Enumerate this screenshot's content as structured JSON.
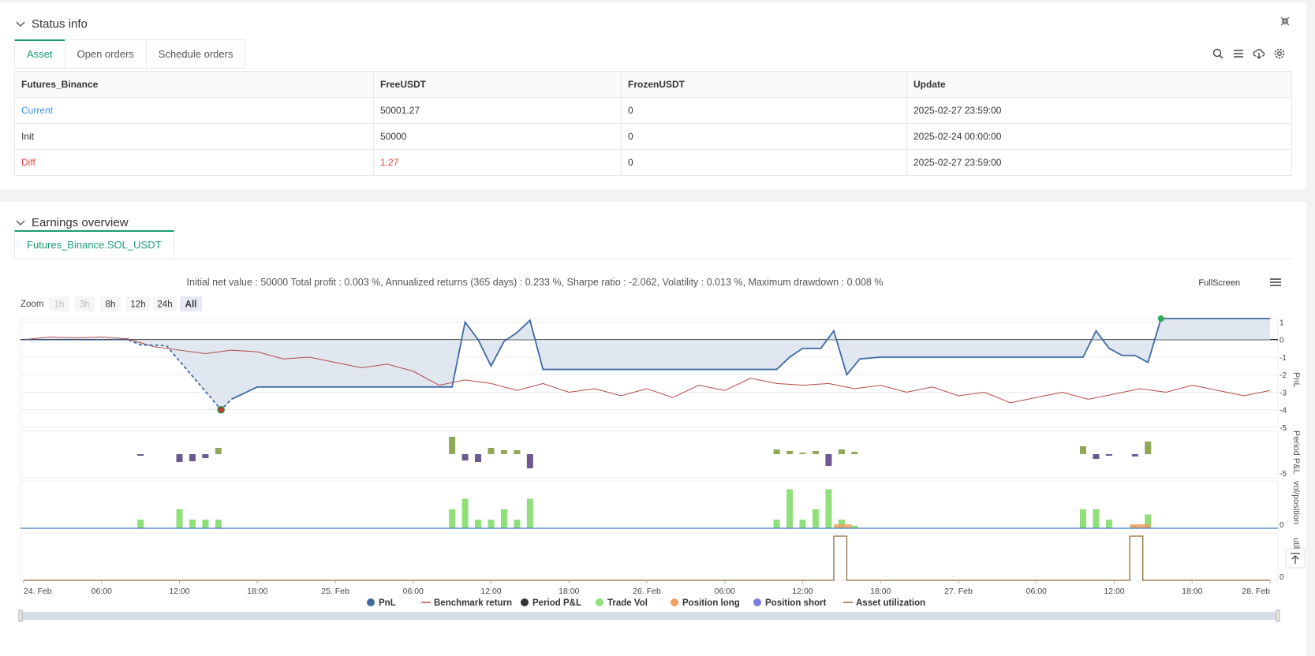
{
  "status": {
    "title": "Status info",
    "tabs": [
      "Asset",
      "Open orders",
      "Schedule orders"
    ],
    "table": {
      "headers": [
        "Futures_Binance",
        "FreeUSDT",
        "FrozenUSDT",
        "Update"
      ],
      "rows": [
        {
          "label": "Current",
          "free": "50001.27",
          "frozen": "0",
          "update": "2025-02-27 23:59:00",
          "color": "#3a8ee6"
        },
        {
          "label": "Init",
          "free": "50000",
          "frozen": "0",
          "update": "2025-02-24 00:00:00",
          "color": "#333333"
        },
        {
          "label": "Diff",
          "free": "1.27",
          "frozen": "0",
          "update": "2025-02-27 23:59:00",
          "color": "#e64545"
        }
      ]
    }
  },
  "earnings": {
    "title": "Earnings overview",
    "tab": "Futures_Binance.SOL_USDT",
    "summary": "Initial net value : 50000 Total profit : 0.003 %, Annualized returns (365 days) : 0.233 %, Sharpe ratio : -2.062, Volatility : 0.013 %, Maximum drawdown : 0.008 %",
    "fullscreen": "FullScreen",
    "zoom_label": "Zoom",
    "zoom_options": [
      "1h",
      "3h",
      "8h",
      "12h",
      "24h",
      "All"
    ]
  },
  "chart_data": {
    "type": "line",
    "x_labels": [
      "24. Feb",
      "06:00",
      "12:00",
      "18:00",
      "25. Feb",
      "06:00",
      "12:00",
      "18:00",
      "26. Feb",
      "06:00",
      "12:00",
      "18:00",
      "27. Feb",
      "06:00",
      "12:00",
      "18:00",
      "28. Feb"
    ],
    "pnl_axis": {
      "label": "PnL",
      "ticks": [
        "1",
        "0",
        "-1",
        "-2",
        "-3",
        "-4",
        "-5"
      ],
      "range": [
        -5,
        1.2
      ]
    },
    "period_axis": {
      "label": "Period P&L",
      "ticks": [
        "-5"
      ]
    },
    "vol_axis": {
      "label": "vol/position",
      "ticks": [
        "0"
      ]
    },
    "util_axis": {
      "label": "utili...on",
      "ticks": [
        "0"
      ]
    },
    "series": [
      {
        "name": "PnL",
        "color": "#3e6aa0",
        "points": [
          [
            0,
            0
          ],
          [
            4,
            0
          ],
          [
            4.5,
            -0.3
          ],
          [
            5.5,
            -0.35
          ],
          [
            7.2,
            -3.3
          ],
          [
            7.6,
            -4
          ],
          [
            8,
            -3.4
          ],
          [
            9,
            -2.7
          ],
          [
            16,
            -2.7
          ],
          [
            16.5,
            -2.7
          ],
          [
            17,
            1
          ],
          [
            17.5,
            0
          ],
          [
            18,
            -1.5
          ],
          [
            18.5,
            -0.1
          ],
          [
            19,
            0.4
          ],
          [
            19.5,
            1.1
          ],
          [
            20,
            -1.7
          ],
          [
            29,
            -1.7
          ],
          [
            29.5,
            -1
          ],
          [
            30,
            -0.5
          ],
          [
            30.7,
            -0.5
          ],
          [
            31.2,
            0.5
          ],
          [
            31.7,
            -2
          ],
          [
            32.2,
            -1.1
          ],
          [
            33,
            -1
          ],
          [
            40.8,
            -1
          ],
          [
            41.3,
            0.5
          ],
          [
            41.8,
            -0.5
          ],
          [
            42.3,
            -0.9
          ],
          [
            42.8,
            -0.9
          ],
          [
            43.3,
            -1.3
          ],
          [
            43.8,
            1.2
          ],
          [
            48,
            1.2
          ]
        ]
      },
      {
        "name": "Benchmark return",
        "color": "#b34a4a",
        "points": [
          [
            0,
            0
          ],
          [
            1,
            0.15
          ],
          [
            2,
            0.1
          ],
          [
            3,
            0.15
          ],
          [
            4,
            0.05
          ],
          [
            5,
            -0.4
          ],
          [
            6,
            -0.6
          ],
          [
            7,
            -0.8
          ],
          [
            8,
            -0.6
          ],
          [
            9,
            -0.7
          ],
          [
            10,
            -1.1
          ],
          [
            11,
            -1
          ],
          [
            12,
            -1.3
          ],
          [
            13,
            -1.6
          ],
          [
            14,
            -1.4
          ],
          [
            15,
            -1.8
          ],
          [
            16,
            -2.6
          ],
          [
            17,
            -2.3
          ],
          [
            18,
            -2.5
          ],
          [
            19,
            -2.9
          ],
          [
            20,
            -2.5
          ],
          [
            21,
            -3
          ],
          [
            22,
            -2.8
          ],
          [
            23,
            -3.2
          ],
          [
            24,
            -2.8
          ],
          [
            25,
            -3.3
          ],
          [
            26,
            -2.6
          ],
          [
            27,
            -2.9
          ],
          [
            28,
            -2.2
          ],
          [
            29,
            -2.5
          ],
          [
            30,
            -2.6
          ],
          [
            31,
            -2.5
          ],
          [
            32,
            -2.8
          ],
          [
            33,
            -2.6
          ],
          [
            34,
            -3
          ],
          [
            35,
            -2.7
          ],
          [
            36,
            -3.2
          ],
          [
            37,
            -3
          ],
          [
            38,
            -3.6
          ],
          [
            39,
            -3.3
          ],
          [
            40,
            -3
          ],
          [
            41,
            -3.4
          ],
          [
            42,
            -3.1
          ],
          [
            43,
            -2.8
          ],
          [
            44,
            -3
          ],
          [
            45,
            -2.6
          ],
          [
            46,
            -2.9
          ],
          [
            47,
            -3.2
          ],
          [
            48,
            -2.9
          ]
        ]
      },
      {
        "name": "Period P&L",
        "color": "#333333"
      },
      {
        "name": "Trade Vol",
        "color": "#90e07a"
      },
      {
        "name": "Position long",
        "color": "#f0a060"
      },
      {
        "name": "Position short",
        "color": "#7b7be0"
      },
      {
        "name": "Asset utilization",
        "color": "#8b6b3d"
      }
    ],
    "period_bars": [
      [
        4.5,
        -0.2
      ],
      [
        6,
        -1
      ],
      [
        6.5,
        -0.9
      ],
      [
        7,
        -0.5
      ],
      [
        7.5,
        0.8
      ],
      [
        16.5,
        2.2
      ],
      [
        17,
        -0.8
      ],
      [
        17.5,
        -1
      ],
      [
        18,
        0.8
      ],
      [
        18.5,
        0.5
      ],
      [
        19,
        0.5
      ],
      [
        19.5,
        -1.8
      ],
      [
        29,
        0.6
      ],
      [
        29.5,
        0.4
      ],
      [
        30,
        0.2
      ],
      [
        30.5,
        0.4
      ],
      [
        31,
        -1.5
      ],
      [
        31.5,
        0.6
      ],
      [
        32,
        0.3
      ],
      [
        40.8,
        1
      ],
      [
        41.3,
        -0.6
      ],
      [
        41.8,
        -0.2
      ],
      [
        42.8,
        -0.3
      ],
      [
        43.3,
        1.6
      ]
    ],
    "trade_vol_bars": [
      [
        4.5,
        1
      ],
      [
        6,
        2.2
      ],
      [
        6.5,
        1
      ],
      [
        7,
        1
      ],
      [
        7.5,
        1
      ],
      [
        16.5,
        2.2
      ],
      [
        17,
        3.4
      ],
      [
        17.5,
        1
      ],
      [
        18,
        1
      ],
      [
        18.5,
        2.2
      ],
      [
        19,
        1
      ],
      [
        19.5,
        3.4
      ],
      [
        29,
        1
      ],
      [
        29.5,
        4.5
      ],
      [
        30,
        1
      ],
      [
        30.5,
        2.2
      ],
      [
        31,
        4.5
      ],
      [
        31.5,
        1
      ],
      [
        32,
        0.3
      ],
      [
        40.8,
        2.2
      ],
      [
        41.3,
        2.2
      ],
      [
        41.8,
        1
      ],
      [
        42.8,
        0.3
      ],
      [
        43.3,
        1.6
      ]
    ],
    "position_long": [
      [
        31.2,
        31.9,
        0.4
      ],
      [
        42.6,
        43.4,
        0.4
      ]
    ],
    "utilization": [
      [
        31.2,
        31.7
      ],
      [
        42.6,
        43.1
      ]
    ]
  }
}
